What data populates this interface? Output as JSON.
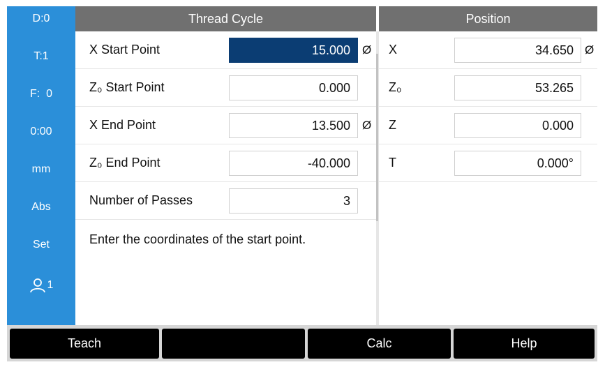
{
  "sidebar": {
    "items": [
      {
        "label": "D:0"
      },
      {
        "label": "T:1"
      },
      {
        "label": "F:  0"
      },
      {
        "label": "0:00"
      },
      {
        "label": "mm"
      },
      {
        "label": "Abs"
      },
      {
        "label": "Set"
      }
    ],
    "user": {
      "icon": "user-icon",
      "label": "1"
    },
    "color": "#2b8fd9"
  },
  "thread_cycle": {
    "title": "Thread Cycle",
    "rows": [
      {
        "label": "X Start Point",
        "value": "15.000",
        "suffix": "Ø"
      },
      {
        "label": "Z₀ Start Point",
        "value": "0.000",
        "suffix": ""
      },
      {
        "label": "X End Point",
        "value": "13.500",
        "suffix": "Ø"
      },
      {
        "label": "Z₀ End Point",
        "value": "-40.000",
        "suffix": ""
      },
      {
        "label": "Number of Passes",
        "value": "3",
        "suffix": ""
      }
    ],
    "message": "Enter the coordinates of the start point."
  },
  "position": {
    "title": "Position",
    "rows": [
      {
        "label": "X",
        "value": "34.650",
        "suffix": "Ø"
      },
      {
        "label": "Z₀",
        "value": "53.265",
        "suffix": ""
      },
      {
        "label": "Z",
        "value": "0.000",
        "suffix": ""
      },
      {
        "label": "T",
        "value": "0.000°",
        "suffix": ""
      }
    ]
  },
  "softkeys": [
    {
      "label": "Teach"
    },
    {
      "label": ""
    },
    {
      "label": "Calc"
    },
    {
      "label": "Help"
    }
  ],
  "colors": {
    "header": "#707070",
    "selected_field": "#0b3d73",
    "softkey": "#000000"
  }
}
